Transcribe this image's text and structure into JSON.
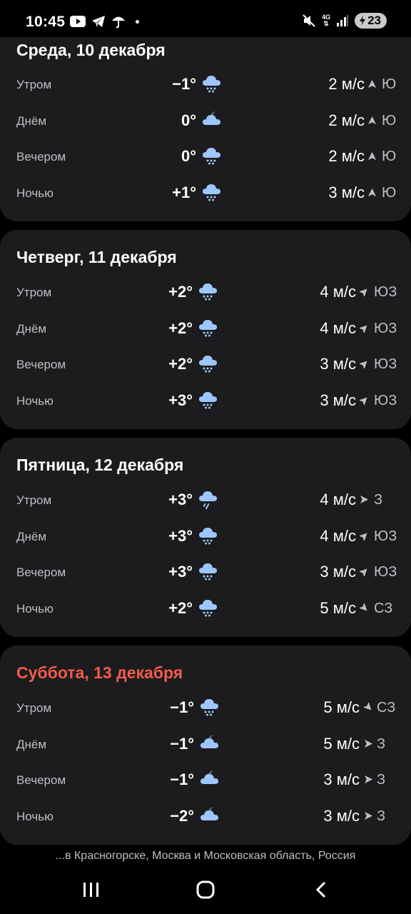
{
  "status_bar": {
    "time": "10:45",
    "battery": "23",
    "network": "4G",
    "left_icons": [
      "youtube-icon",
      "telegram-icon",
      "umbrella-icon",
      "notification-dot"
    ],
    "right_icons": [
      "mute-icon",
      "network-4g-icon",
      "signal-icon",
      "battery-charging-icon"
    ]
  },
  "colors": {
    "card_bg": "#1c1c1e",
    "weekend_red": "#f25b4c",
    "icon_blue": "#9ec6ff",
    "secondary_text": "#bfbfc4"
  },
  "days": [
    {
      "title": "Среда, 10 декабря",
      "weekend": false,
      "rows": [
        {
          "period": "Утром",
          "temp": "−1°",
          "icon": "snow-icon",
          "wind": "2 м/с",
          "arrow": "wind-arrow-n-icon",
          "dir": "Ю"
        },
        {
          "period": "Днём",
          "temp": "0°",
          "icon": "cloudy-night-icon",
          "wind": "2 м/с",
          "arrow": "wind-arrow-n-icon",
          "dir": "Ю"
        },
        {
          "period": "Вечером",
          "temp": "0°",
          "icon": "snow-icon",
          "wind": "2 м/с",
          "arrow": "wind-arrow-n-icon",
          "dir": "Ю"
        },
        {
          "period": "Ночью",
          "temp": "+1°",
          "icon": "snow-icon",
          "wind": "3 м/с",
          "arrow": "wind-arrow-n-icon",
          "dir": "Ю"
        }
      ]
    },
    {
      "title": "Четверг, 11 декабря",
      "weekend": false,
      "rows": [
        {
          "period": "Утром",
          "temp": "+2°",
          "icon": "snow-icon",
          "wind": "4 м/с",
          "arrow": "wind-arrow-ne-icon",
          "dir": "ЮЗ"
        },
        {
          "period": "Днём",
          "temp": "+2°",
          "icon": "snow-icon",
          "wind": "4 м/с",
          "arrow": "wind-arrow-ne-icon",
          "dir": "ЮЗ"
        },
        {
          "period": "Вечером",
          "temp": "+2°",
          "icon": "snow-icon",
          "wind": "3 м/с",
          "arrow": "wind-arrow-ne-icon",
          "dir": "ЮЗ"
        },
        {
          "period": "Ночью",
          "temp": "+3°",
          "icon": "snow-icon",
          "wind": "3 м/с",
          "arrow": "wind-arrow-ne-icon",
          "dir": "ЮЗ"
        }
      ]
    },
    {
      "title": "Пятница, 12 декабря",
      "weekend": false,
      "rows": [
        {
          "period": "Утром",
          "temp": "+3°",
          "icon": "rain-icon",
          "wind": "4 м/с",
          "arrow": "wind-arrow-e-icon",
          "dir": "З"
        },
        {
          "period": "Днём",
          "temp": "+3°",
          "icon": "snow-icon",
          "wind": "4 м/с",
          "arrow": "wind-arrow-ne-icon",
          "dir": "ЮЗ"
        },
        {
          "period": "Вечером",
          "temp": "+3°",
          "icon": "snow-icon",
          "wind": "3 м/с",
          "arrow": "wind-arrow-ne-icon",
          "dir": "ЮЗ"
        },
        {
          "period": "Ночью",
          "temp": "+2°",
          "icon": "snow-icon",
          "wind": "5 м/с",
          "arrow": "wind-arrow-se-icon",
          "dir": "СЗ"
        }
      ]
    },
    {
      "title": "Суббота, 13 декабря",
      "weekend": true,
      "rows": [
        {
          "period": "Утром",
          "temp": "−1°",
          "icon": "snow-icon",
          "wind": "5 м/с",
          "arrow": "wind-arrow-se-icon",
          "dir": "СЗ"
        },
        {
          "period": "Днём",
          "temp": "−1°",
          "icon": "cloudy-night-icon",
          "wind": "5 м/с",
          "arrow": "wind-arrow-e-icon",
          "dir": "З"
        },
        {
          "period": "Вечером",
          "temp": "−1°",
          "icon": "cloudy-night-icon",
          "wind": "3 м/с",
          "arrow": "wind-arrow-e-icon",
          "dir": "З"
        },
        {
          "period": "Ночью",
          "temp": "−2°",
          "icon": "cloudy-night-icon",
          "wind": "3 м/с",
          "arrow": "wind-arrow-e-icon",
          "dir": "З"
        }
      ]
    }
  ],
  "footer": {
    "location": "...в Красногорске, Москва и Московская область, Россия"
  },
  "nav_bar": {
    "buttons": [
      "recent-apps-button",
      "home-button",
      "back-button"
    ]
  }
}
